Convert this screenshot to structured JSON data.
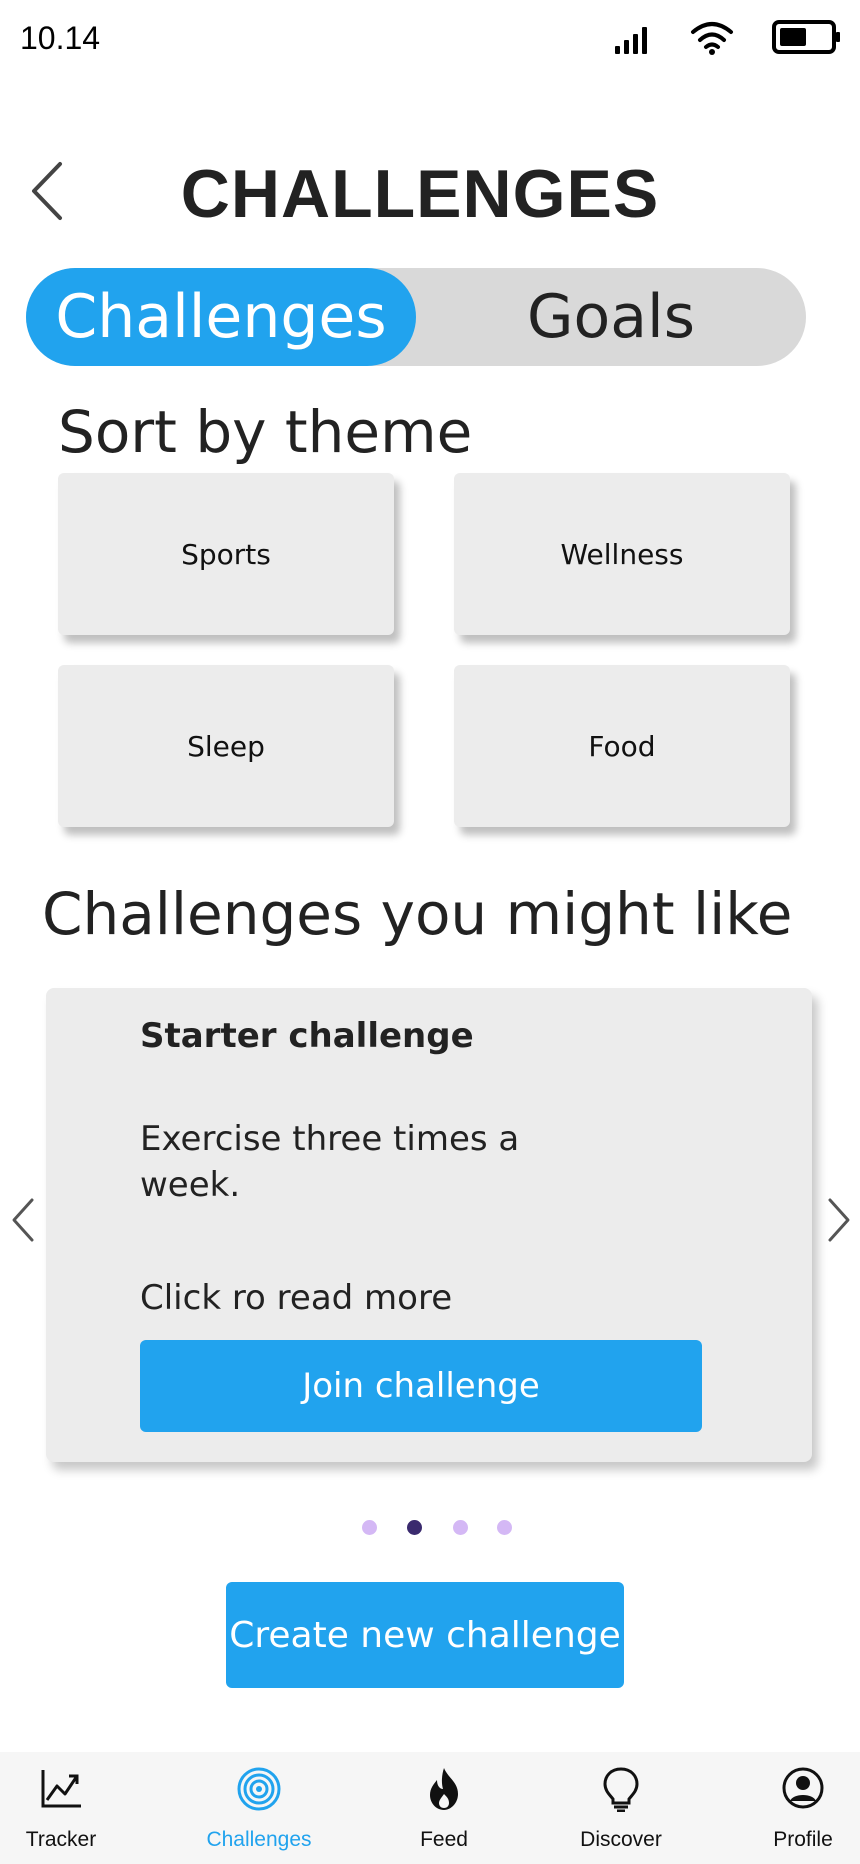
{
  "status_bar": {
    "time": "10.14"
  },
  "header": {
    "title": "CHALLENGES"
  },
  "segmented": {
    "active_label": "Challenges",
    "inactive_label": "Goals"
  },
  "themes": {
    "title": "Sort by theme",
    "items": [
      {
        "label": "Sports"
      },
      {
        "label": "Wellness"
      },
      {
        "label": "Sleep"
      },
      {
        "label": "Food"
      }
    ]
  },
  "recommended": {
    "title": "Challenges you might like",
    "card": {
      "heading": "Starter challenge",
      "description": "Exercise three times a week.",
      "read_more": "Click ro read more",
      "join_label": "Join challenge"
    },
    "pagination": {
      "total": 4,
      "active_index": 1
    }
  },
  "create_button": {
    "label": "Create new challenge"
  },
  "tabbar": {
    "items": [
      {
        "label": "Tracker",
        "icon": "chart-line-icon"
      },
      {
        "label": "Challenges",
        "icon": "target-icon",
        "active": true
      },
      {
        "label": "Feed",
        "icon": "fire-icon"
      },
      {
        "label": "Discover",
        "icon": "lightbulb-icon"
      },
      {
        "label": "Profile",
        "icon": "user-circle-icon"
      }
    ]
  },
  "colors": {
    "accent": "#21a3ee",
    "dot_inactive": "#d4b8f5",
    "dot_active": "#3a2a6e",
    "segment_bg": "#d9d9d9",
    "card_bg": "#ececec"
  }
}
